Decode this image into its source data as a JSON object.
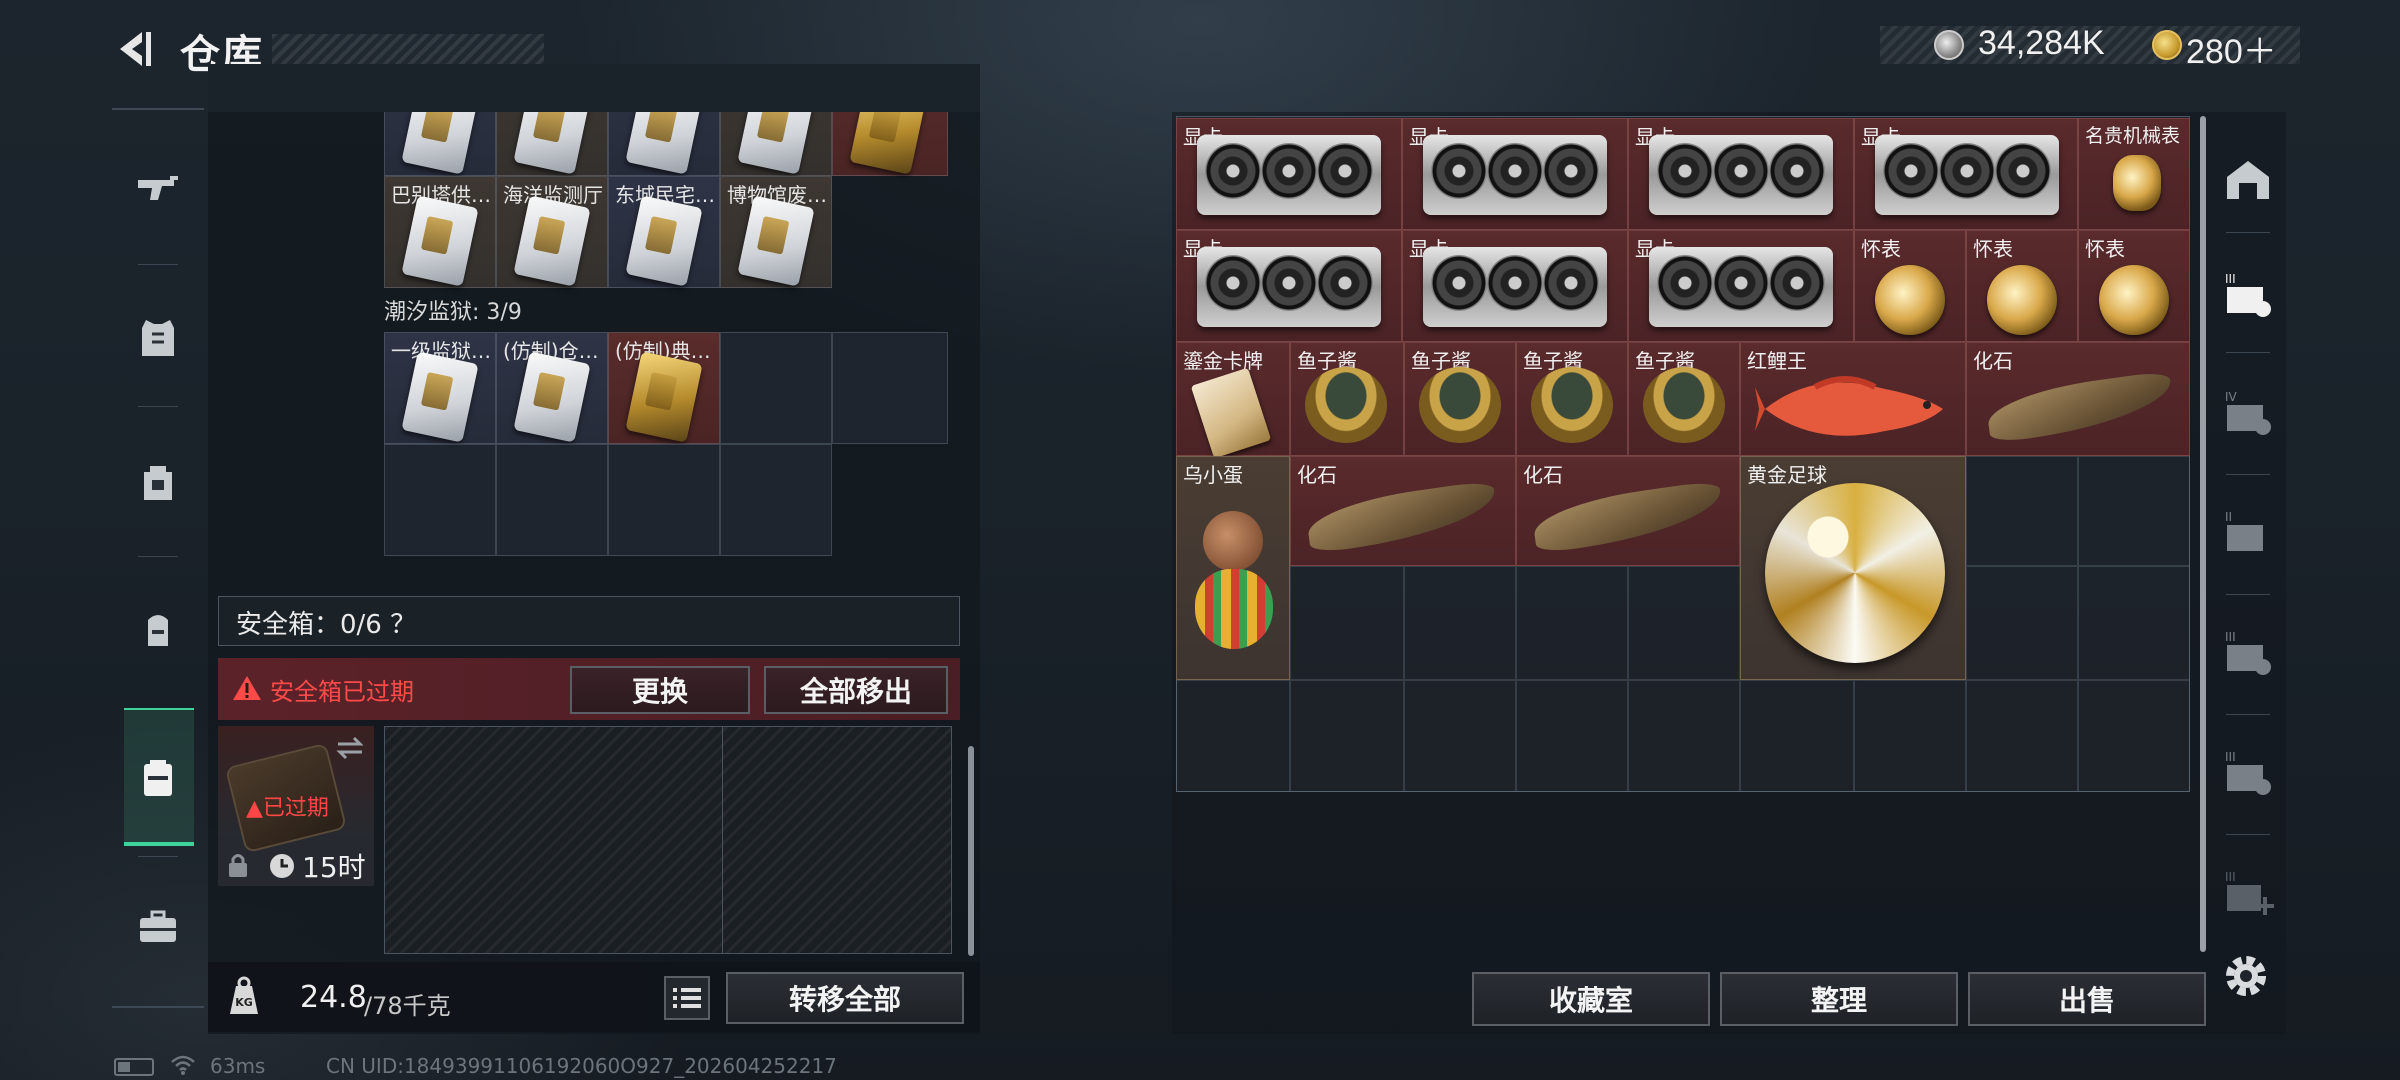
{
  "header": {
    "title": "仓库",
    "currency1": "34,284K",
    "currency2": "280＋"
  },
  "left_panel": {
    "top_row_labels": [
      "巴别塔供…",
      "海洋监测厅",
      "东城民宅…",
      "博物馆废…"
    ],
    "section_label": "潮汐监狱: 3/9",
    "prison_row_labels": [
      "一级监狱…",
      "(仿制)仓…",
      "(仿制)典…"
    ],
    "safe_box_title": "安全箱：0/6 ？",
    "expired_message": "安全箱已过期",
    "replace_label": "更换",
    "move_all_label": "全部移出",
    "safe_item_status": "已过期",
    "safe_item_time": "15时",
    "weight_value": "24.8",
    "weight_unit": "/78千克",
    "transfer_all_label": "转移全部"
  },
  "stash": {
    "items": {
      "gpu": "显卡",
      "watch": "名贵机械表",
      "pocket_watch": "怀表",
      "gold_card": "鎏金卡牌",
      "caviar": "鱼子酱",
      "carp": "红鲤王",
      "fossil": "化石",
      "egg": "乌小蛋",
      "golden_ball": "黄金足球"
    },
    "collection_label": "收藏室",
    "organize_label": "整理",
    "sell_label": "出售"
  },
  "status": {
    "ping": "63ms",
    "uid": "CN UID:18493991106192060O927_202604252217"
  },
  "colors": {
    "accent_green": "#3fd29a",
    "warning_red": "#ff4a4a",
    "item_red": "#5a2a2c"
  }
}
